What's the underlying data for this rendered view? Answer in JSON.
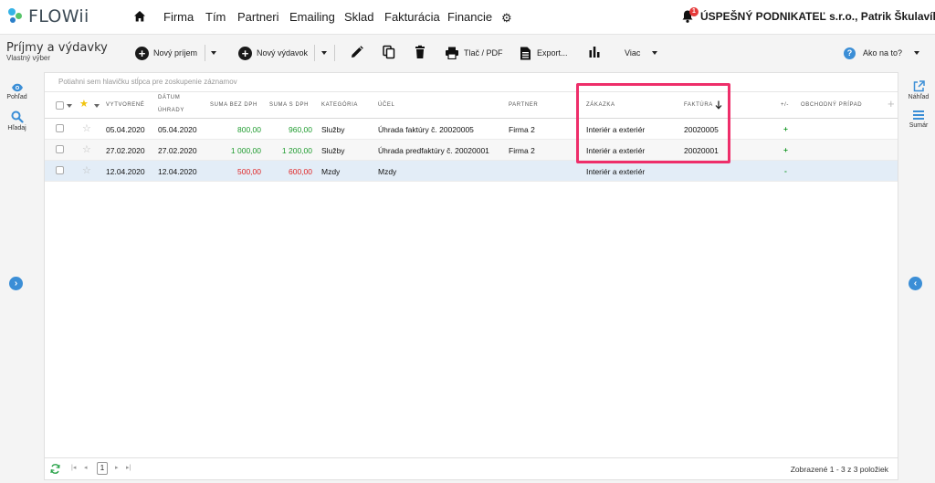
{
  "app": {
    "logo_text": "FLOWii",
    "nav": [
      "Firma",
      "Tím",
      "Partneri",
      "Emailing",
      "Sklad",
      "Fakturácia",
      "Financie"
    ],
    "notification_count": "1",
    "company": "ÚSPEŠNÝ PODNIKATEĽ s.r.o., Patrik Škulavík"
  },
  "toolbar": {
    "title": "Príjmy a výdavky",
    "subtitle": "Vlastný výber",
    "new_income": "Nový príjem",
    "new_expense": "Nový výdavok",
    "print": "Tlač / PDF",
    "export": "Export...",
    "more": "Viac",
    "help": "Ako na to?"
  },
  "leftbar": {
    "view": "Pohľad",
    "search": "Hľadaj"
  },
  "rightbar": {
    "preview": "Náhľad",
    "summary": "Sumár"
  },
  "grid": {
    "group_hint": "Potiahni sem hlavičku stĺpca pre zoskupenie záznamov",
    "headers": {
      "created": "VYTVORENÉ",
      "paid_1": "DÁTUM",
      "paid_2": "ÚHRADY",
      "net": "SUMA BEZ DPH",
      "gross": "SUMA S DPH",
      "category": "KATEGÓRIA",
      "purpose": "ÚČEL",
      "partner": "PARTNER",
      "order": "ZÁKAZKA",
      "invoice": "FAKTÚRA",
      "sign": "+/-",
      "deal": "OBCHODNÝ PRÍPAD"
    },
    "rows": [
      {
        "created": "05.04.2020",
        "paid": "05.04.2020",
        "net": "800,00",
        "gross": "960,00",
        "category": "Služby",
        "purpose": "Úhrada faktúry č. 20020005",
        "partner": "Firma 2",
        "order": "Interiér a exteriér",
        "invoice": "20020005",
        "sign": "+",
        "type": "income"
      },
      {
        "created": "27.02.2020",
        "paid": "27.02.2020",
        "net": "1 000,00",
        "gross": "1 200,00",
        "category": "Služby",
        "purpose": "Úhrada predfaktúry č. 20020001",
        "partner": "Firma 2",
        "order": "Interiér a exteriér",
        "invoice": "20020001",
        "sign": "+",
        "type": "income"
      },
      {
        "created": "12.04.2020",
        "paid": "12.04.2020",
        "net": "500,00",
        "gross": "600,00",
        "category": "Mzdy",
        "purpose": "Mzdy",
        "partner": "",
        "order": "Interiér a exteriér",
        "invoice": "",
        "sign": "-",
        "type": "expense"
      }
    ]
  },
  "footer": {
    "page": "1",
    "shown": "Zobrazené 1 - 3 z 3 položiek"
  },
  "colors": {
    "income": "#1e9b2e",
    "expense": "#e02424",
    "accent": "#3b8ed6",
    "highlight": "#ee2e6a"
  }
}
